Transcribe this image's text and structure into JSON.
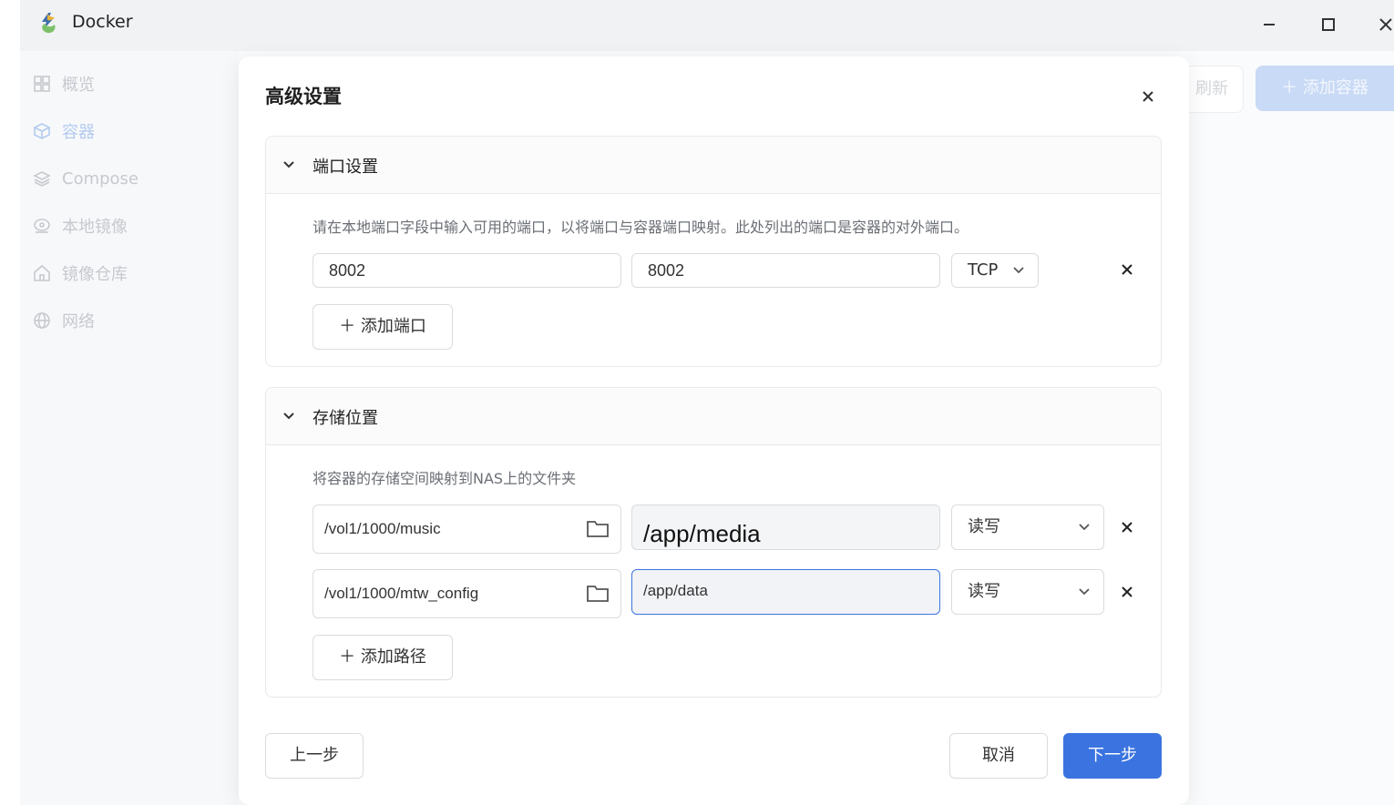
{
  "window": {
    "title": "Docker",
    "minimize_glyph": "—",
    "maximize_glyph": "☐",
    "close_glyph": "✕"
  },
  "sidebar": {
    "items": [
      {
        "label": "概览",
        "icon": "grid-icon"
      },
      {
        "label": "容器",
        "icon": "cube-icon",
        "active": true
      },
      {
        "label": "Compose",
        "icon": "layers-icon"
      },
      {
        "label": "本地镜像",
        "icon": "disc-icon"
      },
      {
        "label": "镜像仓库",
        "icon": "home-icon"
      },
      {
        "label": "网络",
        "icon": "globe-icon"
      }
    ]
  },
  "toolbar": {
    "refresh_label": "刷新",
    "add_container_label": "＋ 添加容器"
  },
  "dialog": {
    "title": "高级设置",
    "close_glyph": "✕",
    "port_section": {
      "title": "端口设置",
      "description": "请在本地端口字段中输入可用的端口，以将端口与容器端口映射。此处列出的端口是容器的对外端口。",
      "rows": [
        {
          "local_port": "8002",
          "container_port": "8002",
          "protocol": "TCP"
        }
      ],
      "add_label": "＋ 添加端口"
    },
    "storage_section": {
      "title": "存储位置",
      "description": "将容器的存储空间映射到NAS上的文件夹",
      "rows": [
        {
          "host_path": "/vol1/1000/music",
          "container_path": "/app/media",
          "mode": "读写"
        },
        {
          "host_path": "/vol1/1000/mtw_config",
          "container_path": "/app/data",
          "mode": "读写"
        }
      ],
      "add_label": "＋ 添加路径"
    },
    "footer": {
      "prev_label": "上一步",
      "cancel_label": "取消",
      "next_label": "下一步"
    }
  },
  "colors": {
    "primary": "#3b74e0",
    "sidebar_bg": "#f7f8fa",
    "titlebar_bg": "#f1f2f4"
  }
}
